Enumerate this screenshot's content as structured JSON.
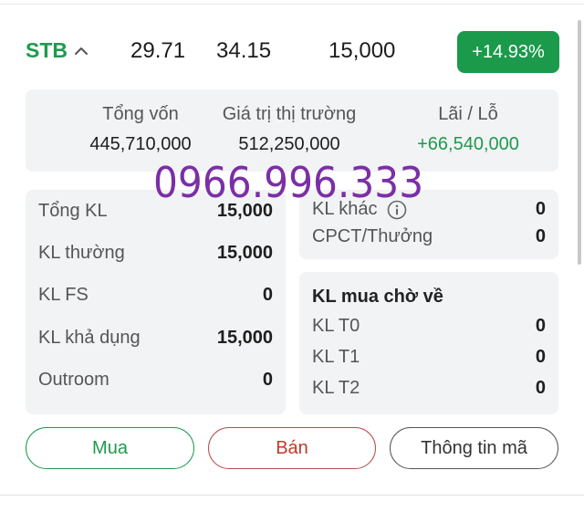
{
  "header": {
    "symbol": "STB",
    "values": [
      "29.71",
      "34.15",
      "15,000"
    ],
    "change_pct": "+14.93%"
  },
  "summary": {
    "cols": [
      {
        "label": "Tổng vốn",
        "value": "445,710,000"
      },
      {
        "label": "Giá trị thị trường",
        "value": "512,250,000"
      },
      {
        "label": "Lãi / Lỗ",
        "value": "+66,540,000"
      }
    ]
  },
  "watermark": "0966.996.333",
  "holdings": [
    {
      "label": "Tổng KL",
      "value": "15,000"
    },
    {
      "label": "KL thường",
      "value": "15,000"
    },
    {
      "label": "KL FS",
      "value": "0"
    },
    {
      "label": "KL khả dụng",
      "value": "15,000"
    },
    {
      "label": "Outroom",
      "value": "0"
    }
  ],
  "other": [
    {
      "label": "KL khác",
      "value": "0"
    },
    {
      "label": "CPCT/Thưởng",
      "value": "0"
    }
  ],
  "pending": {
    "title": "KL mua chờ về",
    "rows": [
      {
        "label": "KL T0",
        "value": "0"
      },
      {
        "label": "KL T1",
        "value": "0"
      },
      {
        "label": "KL T2",
        "value": "0"
      }
    ]
  },
  "actions": {
    "buy": "Mua",
    "sell": "Bán",
    "info": "Thông tin mã"
  },
  "colors": {
    "up_green": "#1e9a4d",
    "badge_green": "#1b9a4b",
    "sell_red": "#c0392b",
    "watermark_purple": "#7b2fa6",
    "card_bg": "#f2f3f5"
  }
}
